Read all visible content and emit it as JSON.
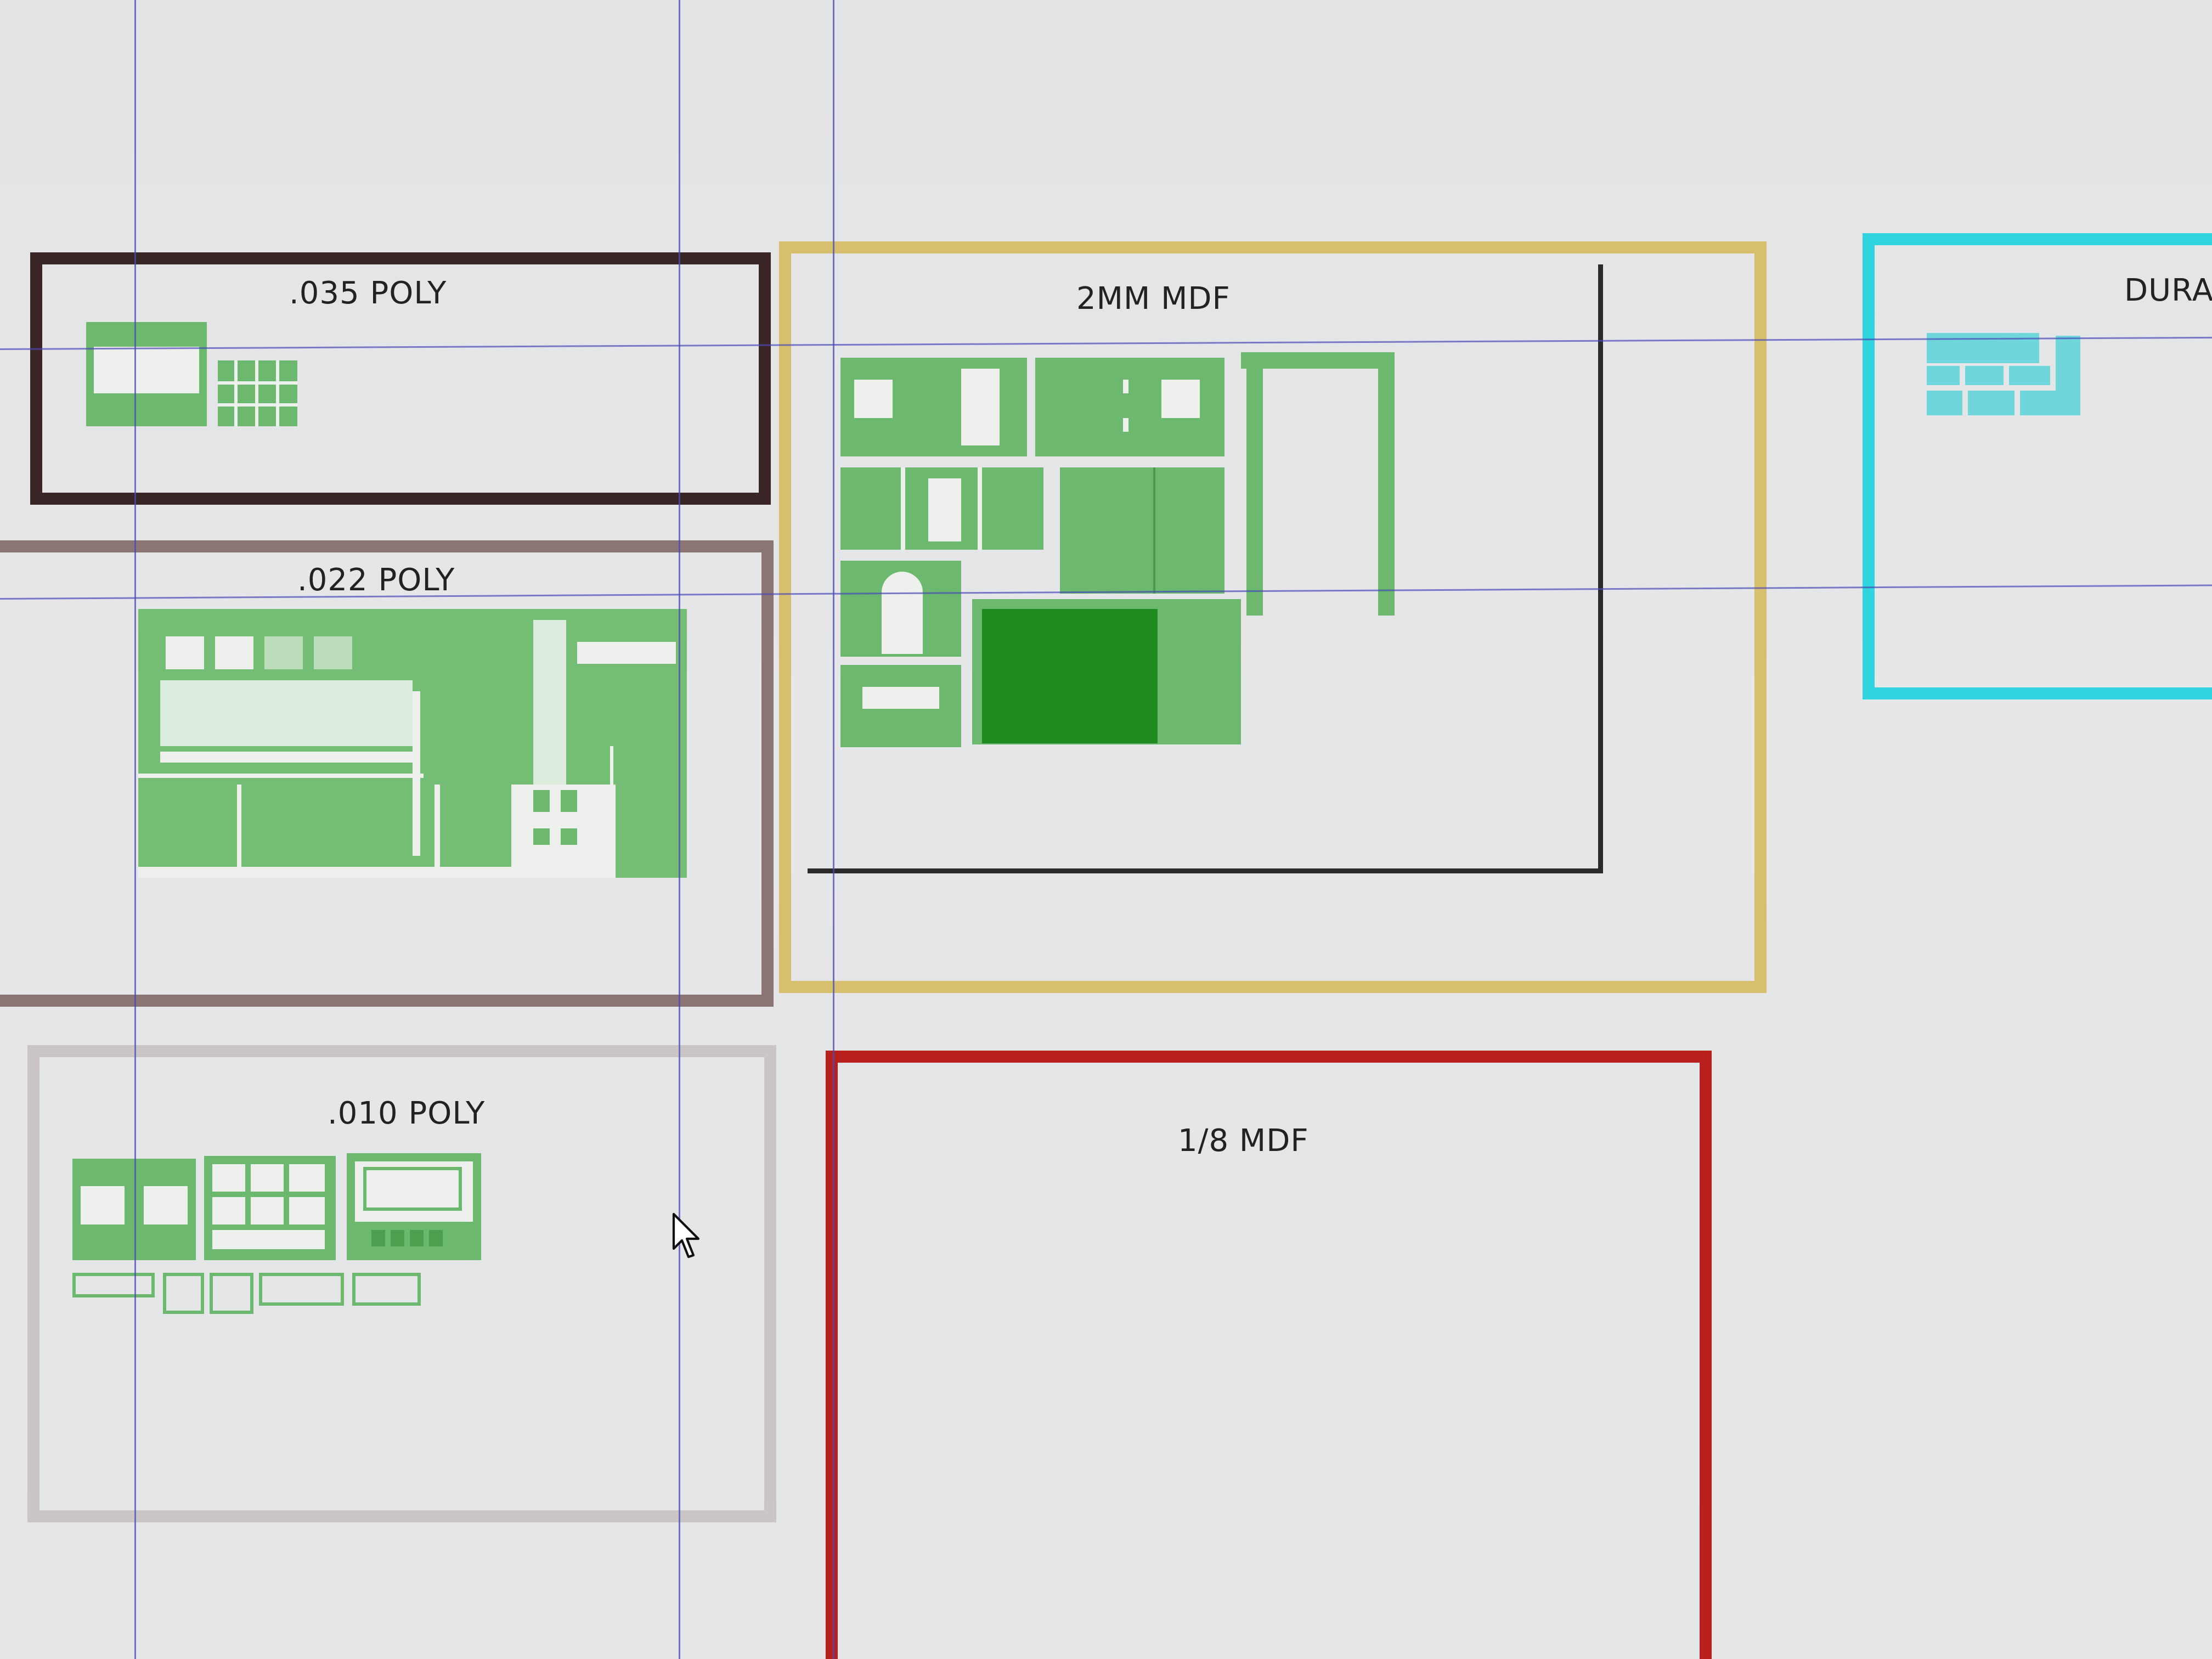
{
  "boards": [
    {
      "id": "poly035",
      "label": ".035 POLY",
      "border_color": "#3a2626"
    },
    {
      "id": "poly022",
      "label": ".022 POLY",
      "border_color": "#8a7474"
    },
    {
      "id": "mdf2mm",
      "label": "2MM MDF",
      "border_color": "#d8bf6e"
    },
    {
      "id": "dura",
      "label": "DURA",
      "border_color": "#2fd4de"
    },
    {
      "id": "poly010",
      "label": ".010 POLY",
      "border_color": "#cbc5c5"
    },
    {
      "id": "mdf18",
      "label": "1/8 MDF",
      "border_color": "#b8201c"
    }
  ],
  "colors": {
    "part_green": "#6cb86e",
    "part_dark_green": "#1f8a1f",
    "part_cyan": "#6fd7dc",
    "guide_line": "#4a4ab8",
    "canvas_bg": "#e4e5e7"
  },
  "icons": {
    "cursor": "arrow-pointer-icon"
  }
}
